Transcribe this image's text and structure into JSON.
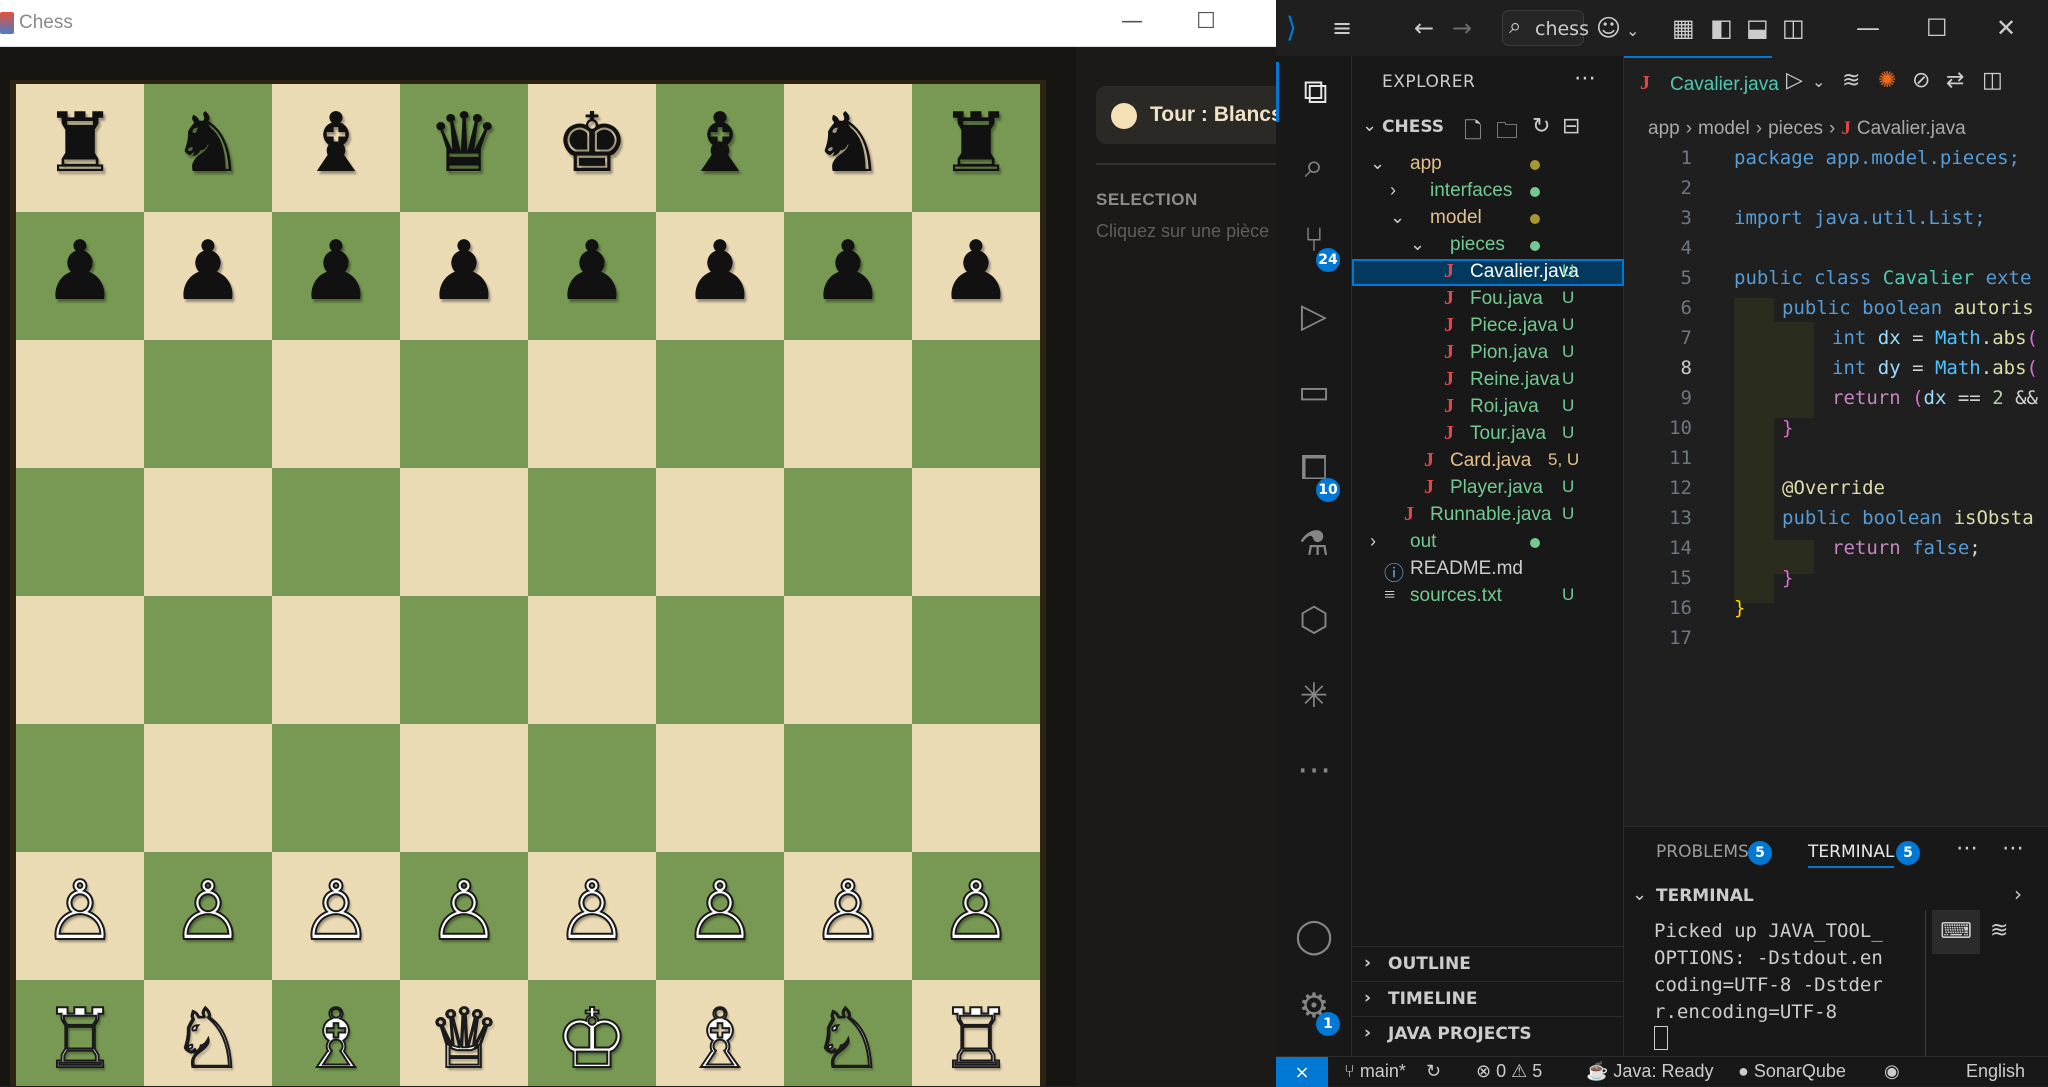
{
  "chess": {
    "window_title": "Chess",
    "minimize_icon": "—",
    "maximize_icon": "☐",
    "turn_label": "Tour : Blancs",
    "selection_heading": "SELECTION",
    "selection_hint": "Cliquez sur une pièce",
    "board_ranks": [
      [
        "♜",
        "♞",
        "♝",
        "♛",
        "♚",
        "♝",
        "♞",
        "♜"
      ],
      [
        "♟",
        "♟",
        "♟",
        "♟",
        "♟",
        "♟",
        "♟",
        "♟"
      ],
      [
        "",
        "",
        "",
        "",
        "",
        "",
        "",
        ""
      ],
      [
        "",
        "",
        "",
        "",
        "",
        "",
        "",
        ""
      ],
      [
        "",
        "",
        "",
        "",
        "",
        "",
        "",
        ""
      ],
      [
        "",
        "",
        "",
        "",
        "",
        "",
        "",
        ""
      ],
      [
        "♙",
        "♙",
        "♙",
        "♙",
        "♙",
        "♙",
        "♙",
        "♙"
      ],
      [
        "♖",
        "♘",
        "♗",
        "♕",
        "♔",
        "♗",
        "♘",
        "♖"
      ]
    ],
    "colors": {
      "light": "#ebdbb5",
      "dark": "#779953"
    }
  },
  "vscode": {
    "search_text": "chess",
    "activity_badges": {
      "source_control": "24",
      "extensions": "10",
      "accounts_gear": "1"
    },
    "explorer_title": "EXPLORER",
    "root_label": "CHESS",
    "tree": [
      {
        "label": "app",
        "color": "#e2c08d",
        "dot": "#a8962e"
      },
      {
        "label": "interfaces",
        "color": "#73c991",
        "dot": "#73c991"
      },
      {
        "label": "model",
        "color": "#e2c08d",
        "dot": "#a8962e"
      },
      {
        "label": "pieces",
        "color": "#73c991",
        "dot": "#73c991"
      },
      {
        "label": "Cavalier.java",
        "color": "#ffffff",
        "status": "U"
      },
      {
        "label": "Fou.java",
        "color": "#73c991",
        "status": "U"
      },
      {
        "label": "Piece.java",
        "color": "#73c991",
        "status": "U"
      },
      {
        "label": "Pion.java",
        "color": "#73c991",
        "status": "U"
      },
      {
        "label": "Reine.java",
        "color": "#73c991",
        "status": "U"
      },
      {
        "label": "Roi.java",
        "color": "#73c991",
        "status": "U"
      },
      {
        "label": "Tour.java",
        "color": "#73c991",
        "status": "U"
      },
      {
        "label": "Card.java",
        "color": "#e2c08d",
        "status": "5, U"
      },
      {
        "label": "Player.java",
        "color": "#73c991",
        "status": "U"
      },
      {
        "label": "Runnable.java",
        "color": "#73c991",
        "status": "U"
      },
      {
        "label": "out",
        "color": "#73c991",
        "dot": "#73c991"
      },
      {
        "label": "README.md",
        "color": "#cccccc"
      },
      {
        "label": "sources.txt",
        "color": "#73c991",
        "status": "U"
      }
    ],
    "sections": {
      "outline": "OUTLINE",
      "timeline": "TIMELINE",
      "java_projects": "JAVA PROJECTS"
    },
    "tab_label": "Cavalier.java",
    "breadcrumb": {
      "a": "app",
      "b": "model",
      "c": "pieces",
      "d": "Cavalier.java"
    },
    "code_lines": [
      "1",
      "2",
      "3",
      "4",
      "5",
      "6",
      "7",
      "8",
      "9",
      "10",
      "11",
      "12",
      "13",
      "14",
      "15",
      "16",
      "17"
    ],
    "code_text": {
      "l1": "package app.model.pieces;",
      "l3": "import java.util.List;",
      "l5a": "public class ",
      "l5b": "Cavalier",
      "l5c": " exte",
      "l6a": "public boolean ",
      "l6b": "autoris",
      "l7a": "int ",
      "l7b": "dx",
      "l7c": " = ",
      "l7d": "Math",
      "l7e": ".",
      "l7f": "abs",
      "l7g": "(",
      "l8a": "int ",
      "l8b": "dy",
      "l8c": " = ",
      "l8d": "Math",
      "l8e": ".",
      "l8f": "abs",
      "l8g": "(",
      "l9a": "return ",
      "l9b": "(",
      "l9c": "dx",
      "l9d": " == ",
      "l9e": "2",
      "l9f": " &&",
      "l10": "}",
      "l12": "@Override",
      "l13a": "public boolean ",
      "l13b": "isObsta",
      "l14a": "return ",
      "l14b": "false",
      "l14c": ";",
      "l15": "}",
      "l16": "}"
    },
    "panel_tabs": {
      "problems": "PROBLEMS",
      "problems_count": "5",
      "terminal": "TERMINAL",
      "terminal_count": "5"
    },
    "terminal_header": "TERMINAL",
    "terminal_output": [
      "Picked up JAVA_TOOL_",
      "OPTIONS: -Dstdout.en",
      "coding=UTF-8 -Dstder",
      "r.encoding=UTF-8"
    ],
    "status": {
      "branch": "main*",
      "errors": "0",
      "warnings": "5",
      "java": "Java: Ready",
      "sonar": "SonarQube",
      "language": "English"
    }
  }
}
